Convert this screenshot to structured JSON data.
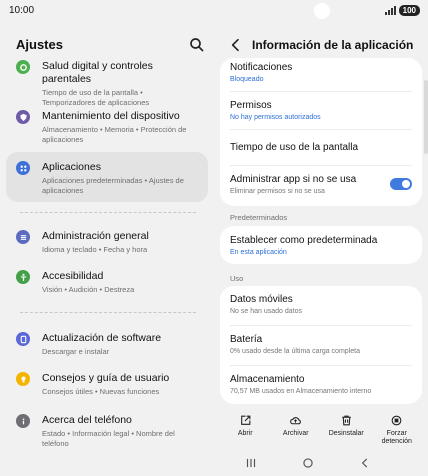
{
  "status_bar": {
    "time": "10:00",
    "battery": "100"
  },
  "left_pane": {
    "title": "Ajustes",
    "items": [
      {
        "title": "Salud digital y controles parentales",
        "subtitle": "Tiempo de uso de la pantalla • Temporizadores de aplicaciones",
        "icon": "digital-wellbeing-icon",
        "color": "#4caf50"
      },
      {
        "title": "Mantenimiento del dispositivo",
        "subtitle": "Almacenamiento • Memoria • Protección de aplicaciones",
        "icon": "device-care-icon",
        "color": "#6f5ba7"
      },
      {
        "title": "Aplicaciones",
        "subtitle": "Aplicaciones predeterminadas • Ajustes de aplicaciones",
        "icon": "apps-icon",
        "color": "#3f6fd8"
      },
      {
        "title": "Administración general",
        "subtitle": "Idioma y teclado • Fecha y hora",
        "icon": "general-management-icon",
        "color": "#5c6bc0"
      },
      {
        "title": "Accesibilidad",
        "subtitle": "Visión • Audición • Destreza",
        "icon": "accessibility-icon",
        "color": "#43a047"
      },
      {
        "title": "Actualización de software",
        "subtitle": "Descargar e instalar",
        "icon": "software-update-icon",
        "color": "#5a67d8"
      },
      {
        "title": "Consejos y guía de usuario",
        "subtitle": "Consejos útiles • Nuevas funciones",
        "icon": "tips-icon",
        "color": "#f4b400"
      },
      {
        "title": "Acerca del teléfono",
        "subtitle": "Estado • Información legal • Nombre del teléfono",
        "icon": "about-phone-icon",
        "color": "#6e6e74"
      }
    ]
  },
  "right_pane": {
    "title": "Información de la aplicación",
    "items": {
      "notifications": {
        "title": "Notificaciones",
        "subtitle": "Bloqueado"
      },
      "permissions": {
        "title": "Permisos",
        "subtitle": "No hay permisos autorizados"
      },
      "screen_time": {
        "title": "Tiempo de uso de la pantalla"
      },
      "manage_unused": {
        "title": "Administrar app si no se usa",
        "subtitle": "Eliminar permisos si no se usa",
        "enabled": true
      },
      "set_default": {
        "title": "Establecer como predeterminada",
        "subtitle": "En esta aplicación"
      },
      "mobile_data": {
        "title": "Datos móviles",
        "subtitle": "No se han usado datos"
      },
      "battery": {
        "title": "Batería",
        "subtitle": "0% usado desde la última carga completa"
      },
      "storage": {
        "title": "Almacenamiento",
        "subtitle": "70,57 MB usados en Almacenamiento interno"
      }
    },
    "sections": {
      "defaults": "Predeterminados",
      "usage": "Uso"
    },
    "actions": {
      "open": "Abrir",
      "archive": "Archivar",
      "uninstall": "Desinstalar",
      "force_stop": "Forzar detención"
    }
  },
  "accent_color": "#3e7ae0"
}
